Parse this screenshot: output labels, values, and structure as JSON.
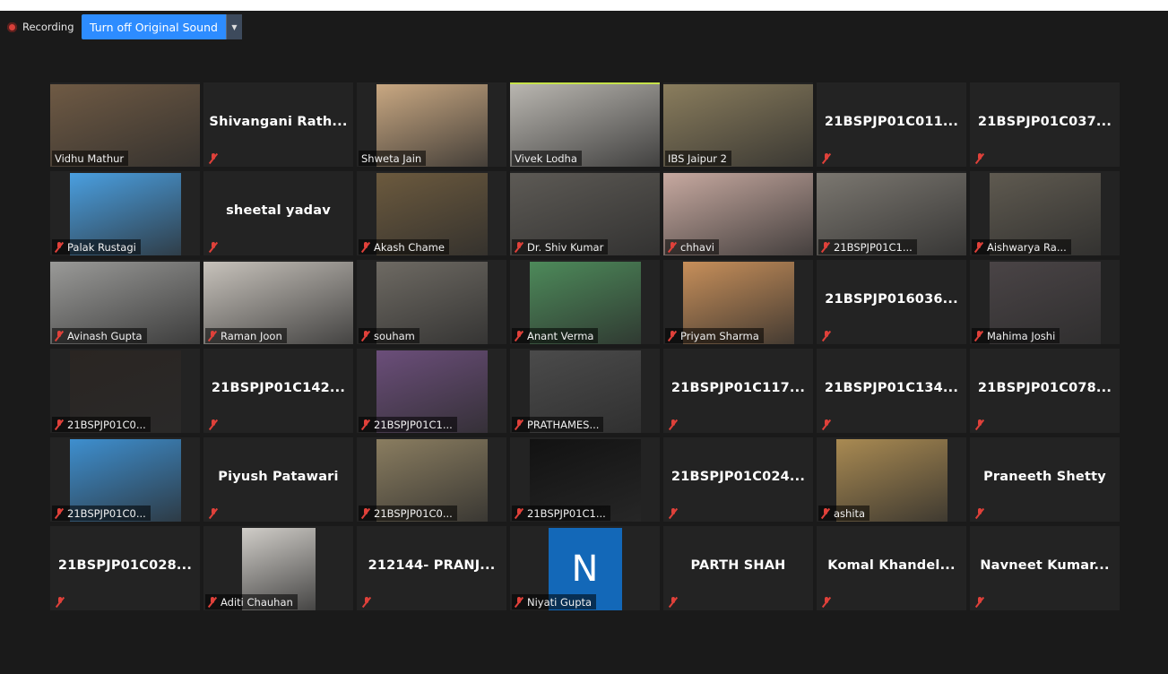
{
  "toolbar": {
    "recording_label": "Recording",
    "sound_button_label": "Turn off Original Sound",
    "sound_dropdown_icon": "caret-down-icon"
  },
  "colors": {
    "speaker_highlight": "#c6e24a",
    "accent_blue": "#2d8cff",
    "muted_red": "#e0413a"
  },
  "participants": [
    {
      "title": "",
      "label": "Vidhu Mathur",
      "muted": false,
      "photo": "#6f5a44"
    },
    {
      "title": "Shivangani Rath...",
      "label": "",
      "muted": true,
      "photo": ""
    },
    {
      "title": "",
      "label": "Shweta Jain",
      "muted": false,
      "photo": "#c9a882"
    },
    {
      "title": "",
      "label": "Vivek Lodha",
      "muted": false,
      "photo": "#b9b6b0",
      "speaking": true
    },
    {
      "title": "",
      "label": "IBS Jaipur 2",
      "muted": false,
      "photo": "#8a7d5d"
    },
    {
      "title": "21BSPJP01C011...",
      "label": "",
      "muted": true,
      "photo": ""
    },
    {
      "title": "21BSPJP01C037...",
      "label": "",
      "muted": true,
      "photo": ""
    },
    {
      "title": "",
      "label": "Palak Rustagi",
      "muted": true,
      "photo": "#4a9fe0"
    },
    {
      "title": "sheetal yadav",
      "label": "",
      "muted": true,
      "photo": ""
    },
    {
      "title": "",
      "label": "Akash Chame",
      "muted": true,
      "photo": "#6c5a3e"
    },
    {
      "title": "",
      "label": "Dr. Shiv Kumar",
      "muted": true,
      "photo": "#5d5a55"
    },
    {
      "title": "",
      "label": "chhavi",
      "muted": true,
      "photo": "#c7a9a0"
    },
    {
      "title": "",
      "label": "21BSPJP01C1...",
      "muted": true,
      "photo": "#7b7770"
    },
    {
      "title": "",
      "label": "Aishwarya Ra...",
      "muted": true,
      "photo": "#5f5a50"
    },
    {
      "title": "",
      "label": "Avinash Gupta",
      "muted": true,
      "photo": "#9a9a98"
    },
    {
      "title": "",
      "label": "Raman Joon",
      "muted": true,
      "photo": "#c7c2bb"
    },
    {
      "title": "",
      "label": "souham",
      "muted": true,
      "photo": "#6e6a63"
    },
    {
      "title": "",
      "label": "Anant Verma",
      "muted": true,
      "photo": "#4d8a5a"
    },
    {
      "title": "",
      "label": "Priyam Sharma",
      "muted": true,
      "photo": "#c78f5a"
    },
    {
      "title": "21BSPJP016036...",
      "label": "",
      "muted": true,
      "photo": ""
    },
    {
      "title": "",
      "label": "Mahima Joshi",
      "muted": true,
      "photo": "#4a4446"
    },
    {
      "title": "",
      "label": "21BSPJP01C0...",
      "muted": true,
      "photo": "#2a2522"
    },
    {
      "title": "21BSPJP01C142...",
      "label": "",
      "muted": true,
      "photo": ""
    },
    {
      "title": "",
      "label": "21BSPJP01C1...",
      "muted": true,
      "photo": "#6b4e7a"
    },
    {
      "title": "",
      "label": "PRATHAMES...",
      "muted": true,
      "photo": "#4b4b4b"
    },
    {
      "title": "21BSPJP01C117...",
      "label": "",
      "muted": true,
      "photo": ""
    },
    {
      "title": "21BSPJP01C134...",
      "label": "",
      "muted": true,
      "photo": ""
    },
    {
      "title": "21BSPJP01C078...",
      "label": "",
      "muted": true,
      "photo": ""
    },
    {
      "title": "",
      "label": "21BSPJP01C0...",
      "muted": true,
      "photo": "#3e8fcf"
    },
    {
      "title": "Piyush Patawari",
      "label": "",
      "muted": true,
      "photo": ""
    },
    {
      "title": "",
      "label": "21BSPJP01C0...",
      "muted": true,
      "photo": "#8a7d60"
    },
    {
      "title": "",
      "label": "21BSPJP01C1...",
      "muted": true,
      "photo": "#121212"
    },
    {
      "title": "21BSPJP01C024...",
      "label": "",
      "muted": true,
      "photo": ""
    },
    {
      "title": "",
      "label": "ashita",
      "muted": true,
      "photo": "#a98a52"
    },
    {
      "title": "Praneeth Shetty",
      "label": "",
      "muted": true,
      "photo": ""
    },
    {
      "title": "21BSPJP01C028...",
      "label": "",
      "muted": true,
      "photo": ""
    },
    {
      "title": "",
      "label": "Aditi Chauhan",
      "muted": true,
      "photo": "#d0cdc8"
    },
    {
      "title": "212144- PRANJ...",
      "label": "",
      "muted": true,
      "photo": ""
    },
    {
      "title": "",
      "label": "Niyati Gupta",
      "muted": true,
      "initial": "N"
    },
    {
      "title": "PARTH SHAH",
      "label": "",
      "muted": true,
      "photo": ""
    },
    {
      "title": "Komal Khandel...",
      "label": "",
      "muted": true,
      "photo": ""
    },
    {
      "title": "Navneet Kumar...",
      "label": "",
      "muted": true,
      "photo": ""
    }
  ]
}
